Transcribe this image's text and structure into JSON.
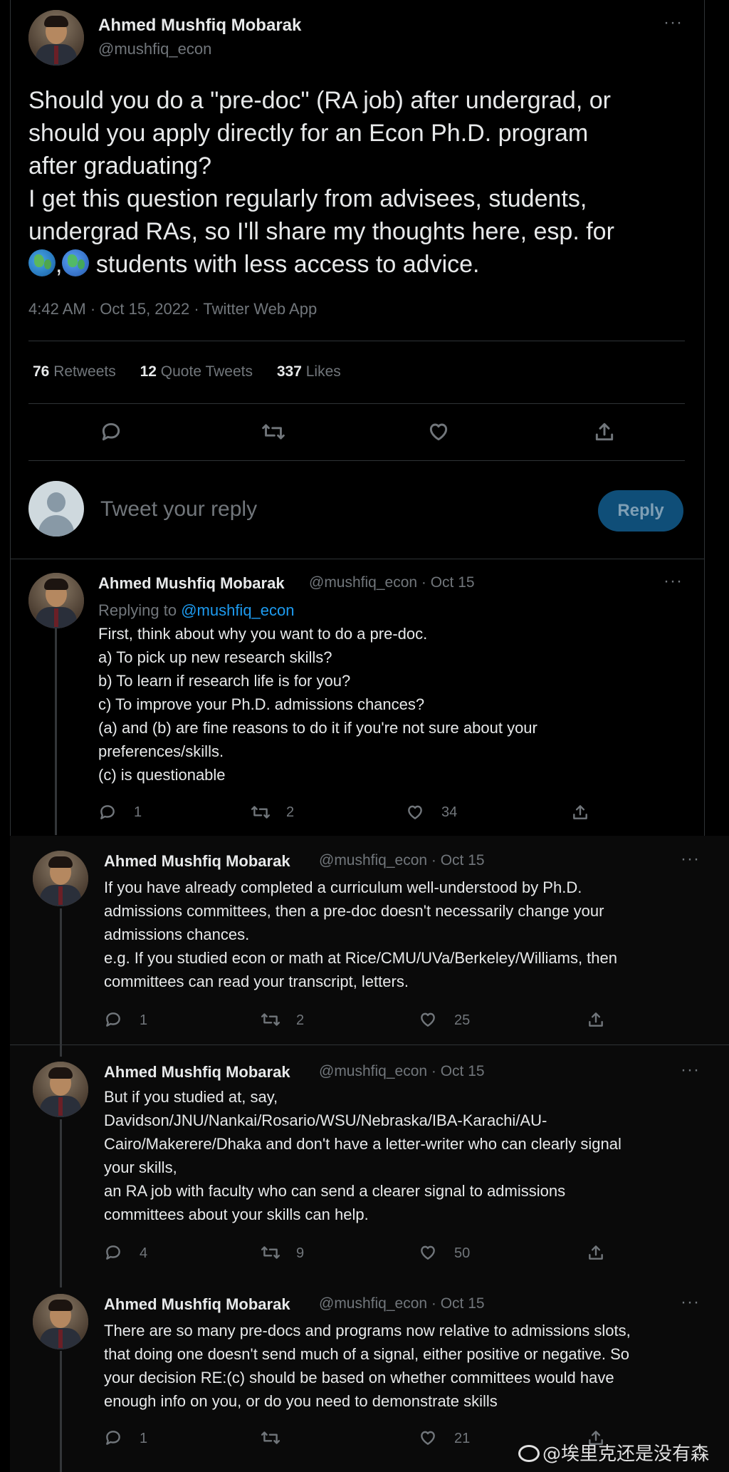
{
  "main_tweet": {
    "name": "Ahmed Mushfiq Mobarak",
    "handle": "@mushfiq_econ",
    "more": "···",
    "text_lines": [
      "Should you do a \"pre-doc\" (RA job) after undergrad, or",
      "should you apply directly for an Econ Ph.D. program",
      "after graduating?",
      "I get this question regularly from advisees, students,",
      "undergrad RAs, so I'll share my thoughts here, esp. for"
    ],
    "last_line_sep": ",",
    "last_line_text": " students with less access to advice.",
    "emoji_icons": [
      "globe-africa-icon",
      "globe-asia-icon"
    ],
    "meta": "4:42 AM · Oct 15, 2022 · Twitter Web App",
    "stats": {
      "retweets_count": "76",
      "retweets_label": "Retweets",
      "quotes_count": "12",
      "quotes_label": "Quote Tweets",
      "likes_count": "337",
      "likes_label": "Likes"
    }
  },
  "reply_box": {
    "placeholder": "Tweet your reply",
    "button_label": "Reply"
  },
  "replies": [
    {
      "name": "Ahmed Mushfiq Mobarak",
      "handle_date": "@mushfiq_econ · Oct 15",
      "replying_prefix": "Replying to ",
      "replying_handle": "@mushfiq_econ",
      "lines": [
        "First, think about why you want to do a pre-doc.",
        "a) To pick up new research skills?",
        "b) To learn if research life is for you?",
        "c) To improve your Ph.D. admissions chances?",
        "(a) and (b) are fine reasons to do it if you're not sure about your",
        "preferences/skills.",
        "(c) is questionable"
      ],
      "replies": "1",
      "retweets": "2",
      "likes": "34"
    },
    {
      "name": "Ahmed Mushfiq Mobarak",
      "handle_date": "@mushfiq_econ · Oct 15",
      "lines": [
        "If you have already completed a curriculum well-understood by Ph.D.",
        "admissions committees, then a pre-doc doesn't necessarily change your",
        "admissions chances.",
        "e.g. If you studied econ or math at Rice/CMU/UVa/Berkeley/Williams, then",
        "committees can read your transcript, letters."
      ],
      "replies": "1",
      "retweets": "2",
      "likes": "25"
    },
    {
      "name": "Ahmed Mushfiq Mobarak",
      "handle_date": "@mushfiq_econ · Oct 15",
      "lines": [
        "But if you studied at, say,",
        "Davidson/JNU/Nankai/Rosario/WSU/Nebraska/IBA-Karachi/AU-",
        "Cairo/Makerere/Dhaka and don't have a letter-writer who can clearly signal",
        "your skills,",
        "an RA job with faculty who can send a clearer signal to admissions",
        "committees about your skills can help."
      ],
      "replies": "4",
      "retweets": "9",
      "likes": "50"
    },
    {
      "name": "Ahmed Mushfiq Mobarak",
      "handle_date": "@mushfiq_econ · Oct 15",
      "lines": [
        "There are so many pre-docs and programs now relative to admissions slots,",
        "that doing one doesn't send much of a signal, either positive or negative. So",
        "your decision RE:(c) should be based on whether committees would have",
        "enough info on you, or do you need to demonstrate skills"
      ],
      "replies": "1",
      "retweets": "",
      "likes": "21"
    }
  ],
  "watermark": "@埃里克还是没有森"
}
